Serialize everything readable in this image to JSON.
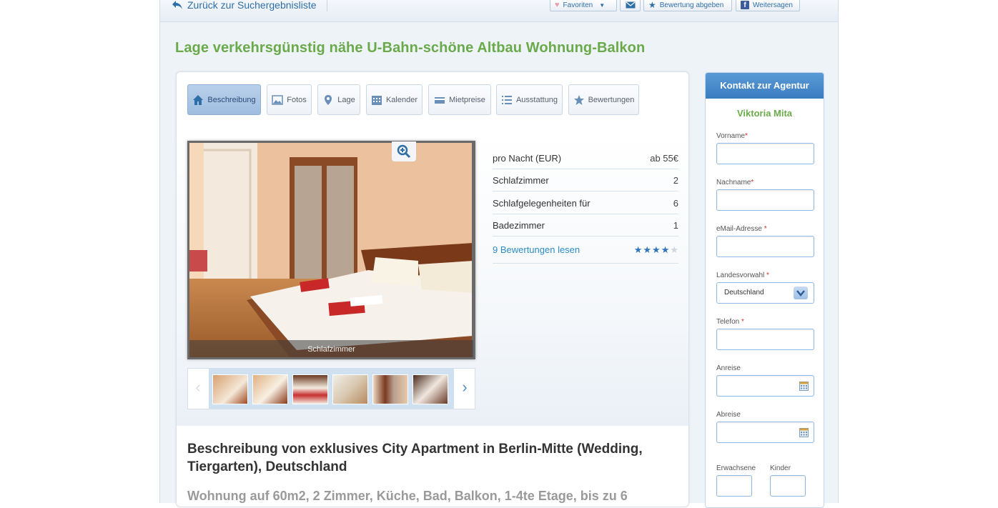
{
  "topbar": {
    "back_label": "Zurück zur Suchergebnisliste",
    "favorites_label": "Favoriten",
    "rate_label": "Bewertung abgeben",
    "share_label": "Weitersagen"
  },
  "listing": {
    "title": "Lage verkehrsgünstig nähe U-Bahn-schöne Altbau Wohnung-Balkon"
  },
  "tabs": [
    {
      "label": "Beschreibung",
      "icon": "home-icon",
      "active": true
    },
    {
      "label": "Fotos",
      "icon": "photo-icon",
      "active": false
    },
    {
      "label": "Lage",
      "icon": "map-pin-icon",
      "active": false
    },
    {
      "label": "Kalender",
      "icon": "calendar-icon",
      "active": false
    },
    {
      "label": "Mietpreise",
      "icon": "price-card-icon",
      "active": false
    },
    {
      "label": "Ausstattung",
      "icon": "list-icon",
      "active": false
    },
    {
      "label": "Bewertungen",
      "icon": "star-icon",
      "active": false
    }
  ],
  "photo": {
    "caption": "Schlafzimmer"
  },
  "facts": [
    {
      "label": "pro Nacht (EUR)",
      "value": "ab 55€"
    },
    {
      "label": "Schlafzimmer",
      "value": "2"
    },
    {
      "label": "Schlafgelegenheiten für",
      "value": "6"
    },
    {
      "label": "Badezimmer",
      "value": "1"
    }
  ],
  "reviews": {
    "link_label": "9 Bewertungen lesen",
    "rating": 4,
    "max": 5
  },
  "description": {
    "title": "Beschreibung von exklusives City Apartment in Berlin-Mitte (Wedding, Tiergarten), Deutschland",
    "subtitle": "Wohnung auf 60m2, 2 Zimmer, Küche, Bad, Balkon, 1-4te Etage, bis zu 6"
  },
  "contact": {
    "header": "Kontakt zur Agentur",
    "agent": "Viktoria Mita",
    "fields": {
      "vorname": "Vorname",
      "nachname": "Nachname",
      "email": "eMail-Adresse",
      "landesvorwahl": "Landesvorwahl",
      "landesvorwahl_value": "Deutschland",
      "telefon": "Telefon",
      "anreise": "Anreise",
      "abreise": "Abreise",
      "erwachsene": "Erwachsene",
      "kinder": "Kinder"
    },
    "required_mark": "*"
  },
  "colors": {
    "title_green": "#6aaa4a",
    "link_blue": "#2e8cc7",
    "contact_header": "#3a7cc0"
  }
}
